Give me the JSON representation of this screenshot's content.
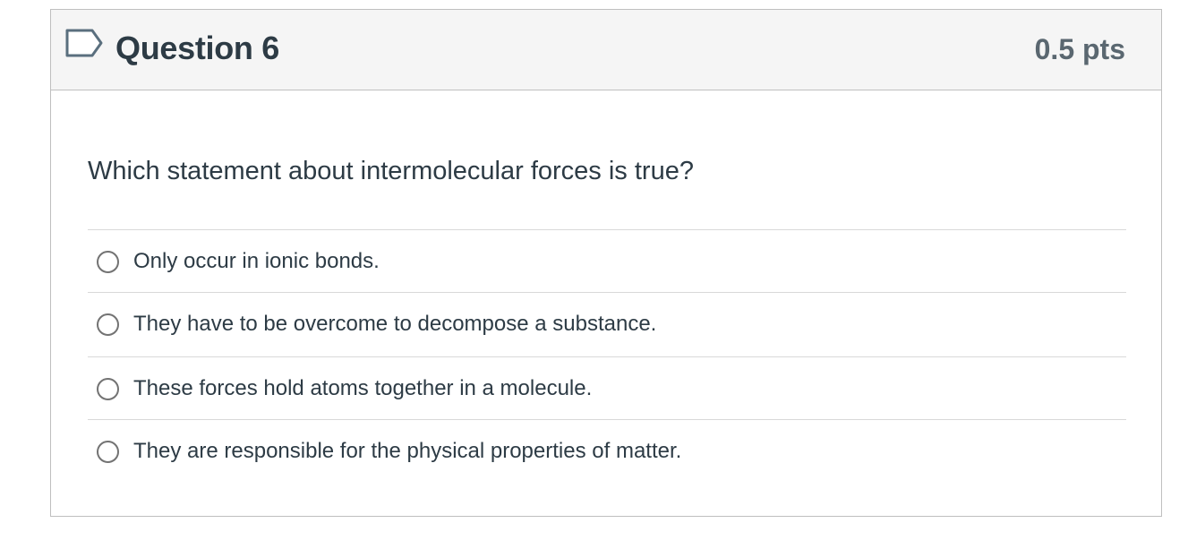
{
  "question": {
    "title": "Question 6",
    "points": "0.5 pts",
    "flag_icon": "flag-outline-icon",
    "text": "Which statement about intermolecular forces is true?",
    "answers": [
      {
        "label": "Only occur in ionic bonds.",
        "selected": false
      },
      {
        "label": "They have to be overcome to decompose a substance.",
        "selected": false
      },
      {
        "label": "These forces hold atoms together in a molecule.",
        "selected": false
      },
      {
        "label": "They are responsible for the physical properties of matter.",
        "selected": false
      }
    ]
  },
  "colors": {
    "header_background": "#f5f5f5",
    "border": "#bfbfbf",
    "text_primary": "#2d3b45",
    "text_points": "#5a6770",
    "radio_border": "#737373"
  }
}
